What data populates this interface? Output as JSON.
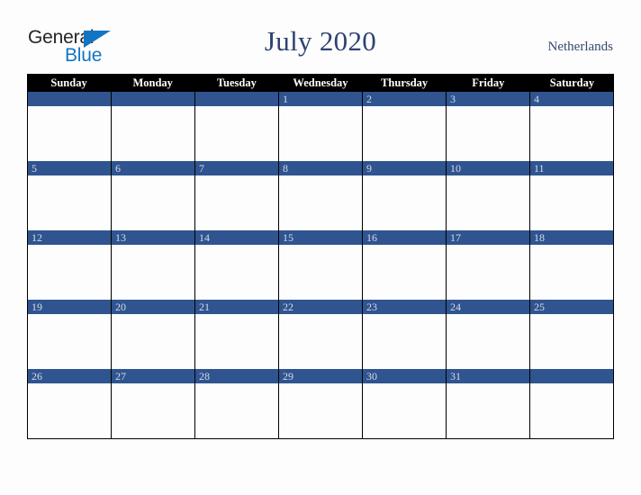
{
  "brand": {
    "line_one": "General",
    "line_two": "Blue",
    "triangle_color": "#1275c4",
    "text_color": "#262626"
  },
  "header": {
    "title": "July 2020",
    "region": "Netherlands",
    "title_color": "#2e4272",
    "region_color": "#33496f"
  },
  "calendar": {
    "weekday_names": [
      "Sunday",
      "Monday",
      "Tuesday",
      "Wednesday",
      "Thursday",
      "Friday",
      "Saturday"
    ],
    "header_background": "#000000",
    "header_text_color": "#ffffff",
    "date_bar_color": "#2f5490",
    "date_text_color": "#d6dbe8",
    "cell_background": "#fdfdfd",
    "grid_line_color": "#000000",
    "weeks": [
      {
        "days": [
          {
            "number": ""
          },
          {
            "number": ""
          },
          {
            "number": ""
          },
          {
            "number": "1"
          },
          {
            "number": "2"
          },
          {
            "number": "3"
          },
          {
            "number": "4"
          }
        ]
      },
      {
        "days": [
          {
            "number": "5"
          },
          {
            "number": "6"
          },
          {
            "number": "7"
          },
          {
            "number": "8"
          },
          {
            "number": "9"
          },
          {
            "number": "10"
          },
          {
            "number": "11"
          }
        ]
      },
      {
        "days": [
          {
            "number": "12"
          },
          {
            "number": "13"
          },
          {
            "number": "14"
          },
          {
            "number": "15"
          },
          {
            "number": "16"
          },
          {
            "number": "17"
          },
          {
            "number": "18"
          }
        ]
      },
      {
        "days": [
          {
            "number": "19"
          },
          {
            "number": "20"
          },
          {
            "number": "21"
          },
          {
            "number": "22"
          },
          {
            "number": "23"
          },
          {
            "number": "24"
          },
          {
            "number": "25"
          }
        ]
      },
      {
        "days": [
          {
            "number": "26"
          },
          {
            "number": "27"
          },
          {
            "number": "28"
          },
          {
            "number": "29"
          },
          {
            "number": "30"
          },
          {
            "number": "31"
          },
          {
            "number": ""
          }
        ]
      }
    ]
  }
}
